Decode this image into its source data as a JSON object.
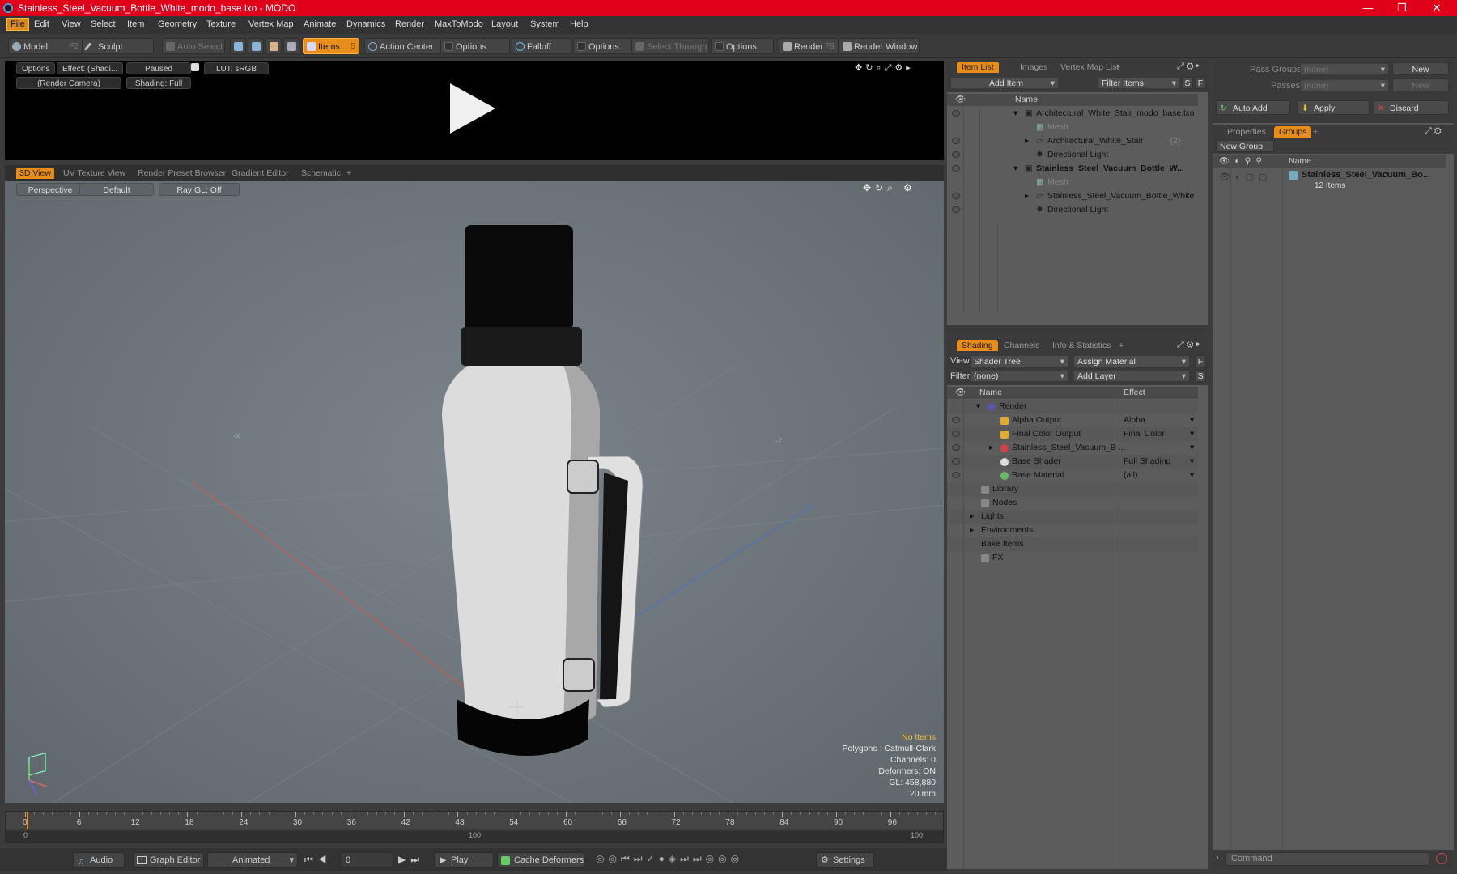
{
  "window": {
    "title": "Stainless_Steel_Vacuum_Bottle_White_modo_base.lxo - MODO",
    "controls": [
      "—",
      "❐",
      "✕"
    ]
  },
  "menu": [
    "File",
    "Edit",
    "View",
    "Select",
    "Item",
    "Geometry",
    "Texture",
    "Vertex Map",
    "Animate",
    "Dynamics",
    "Render",
    "MaxToModo",
    "Layout",
    "System",
    "Help"
  ],
  "toolbar": {
    "model": "Model",
    "model_key": "F2",
    "sculpt": "Sculpt",
    "auto_select": "Auto Select",
    "items": "Items",
    "items_key": "5",
    "action_center": "Action Center",
    "options1": "Options",
    "falloff": "Falloff",
    "options2": "Options",
    "select_through": "Select Through",
    "options3": "Options",
    "render": "Render",
    "render_key": "F9",
    "render_window": "Render Window"
  },
  "preview": {
    "options": "Options",
    "effect": "Effect: (Shadi...",
    "paused": "Paused",
    "lut": "LUT: sRGB",
    "camera": "(Render Camera)",
    "shading": "Shading: Full"
  },
  "view_tabs": [
    "3D View",
    "UV Texture View",
    "Render Preset Browser",
    "Gradient Editor",
    "Schematic",
    "+"
  ],
  "viewport": {
    "perspective": "Perspective",
    "default": "Default",
    "raygl": "Ray GL: Off",
    "axis_x": "-X",
    "axis_z": "-Z",
    "stats": {
      "no_items": "No Items",
      "polygons": "Polygons : Catmull-Clark",
      "channels": "Channels: 0",
      "deformers": "Deformers: ON",
      "gl": "GL: 458,880",
      "size": "20 mm"
    }
  },
  "timeline": {
    "ticks": [
      "0",
      "6",
      "12",
      "18",
      "24",
      "30",
      "36",
      "42",
      "48",
      "54",
      "60",
      "66",
      "72",
      "78",
      "84",
      "90",
      "96"
    ],
    "range_start": "0",
    "range_mid": "100",
    "range_end": "100"
  },
  "bottombar": {
    "audio": "Audio",
    "graph_editor": "Graph Editor",
    "animated": "Animated",
    "frame": "0",
    "play": "Play",
    "cache": "Cache Deformers",
    "settings": "Settings"
  },
  "item_list": {
    "tabs": [
      "Item List",
      "Images",
      "Vertex Map List",
      "+"
    ],
    "add_item": "Add Item",
    "filter": "Filter Items",
    "s": "S",
    "f": "F",
    "col_name": "Name",
    "rows": [
      {
        "label": "Architectural_White_Stair_modo_base.lxo",
        "suffix": ""
      },
      {
        "label": "Mesh",
        "suffix": ""
      },
      {
        "label": "Architectural_White_Stair",
        "suffix": "(2)"
      },
      {
        "label": "Directional Light",
        "suffix": ""
      },
      {
        "label": "Stainless_Steel_Vacuum_Bottle_W...",
        "suffix": ""
      },
      {
        "label": "Mesh",
        "suffix": ""
      },
      {
        "label": "Stainless_Steel_Vacuum_Bottle_White",
        "suffix": ""
      },
      {
        "label": "Directional Light",
        "suffix": ""
      }
    ]
  },
  "shading": {
    "tabs": [
      "Shading",
      "Channels",
      "Info & Statistics",
      "+"
    ],
    "view_label": "View",
    "view_value": "Shader Tree",
    "assign_material": "Assign Material",
    "filter_label": "Filter",
    "filter_value": "(none)",
    "add_layer": "Add Layer",
    "col_name": "Name",
    "col_effect": "Effect",
    "rows": [
      {
        "label": "Render",
        "effect": ""
      },
      {
        "label": "Alpha Output",
        "effect": "Alpha"
      },
      {
        "label": "Final Color Output",
        "effect": "Final Color"
      },
      {
        "label": "Stainless_Steel_Vacuum_B ...",
        "effect": ""
      },
      {
        "label": "Base Shader",
        "effect": "Full Shading"
      },
      {
        "label": "Base Material",
        "effect": "(all)"
      },
      {
        "label": "Library",
        "effect": ""
      },
      {
        "label": "Nodes",
        "effect": ""
      },
      {
        "label": "Lights",
        "effect": ""
      },
      {
        "label": "Environments",
        "effect": ""
      },
      {
        "label": "Bake Items",
        "effect": ""
      },
      {
        "label": "FX",
        "effect": ""
      }
    ]
  },
  "groups": {
    "pass_groups": "Pass Groups",
    "passes": "Passes",
    "none1": "(none)",
    "none2": "(none)",
    "new1": "New",
    "new2": "New",
    "auto_add": "Auto Add",
    "apply": "Apply",
    "discard": "Discard",
    "tabs": [
      "Properties",
      "Groups",
      "+"
    ],
    "new_group": "New Group",
    "col_name": "Name",
    "group_name": "Stainless_Steel_Vacuum_Bo...",
    "group_count": "12 Items",
    "command": "Command"
  }
}
